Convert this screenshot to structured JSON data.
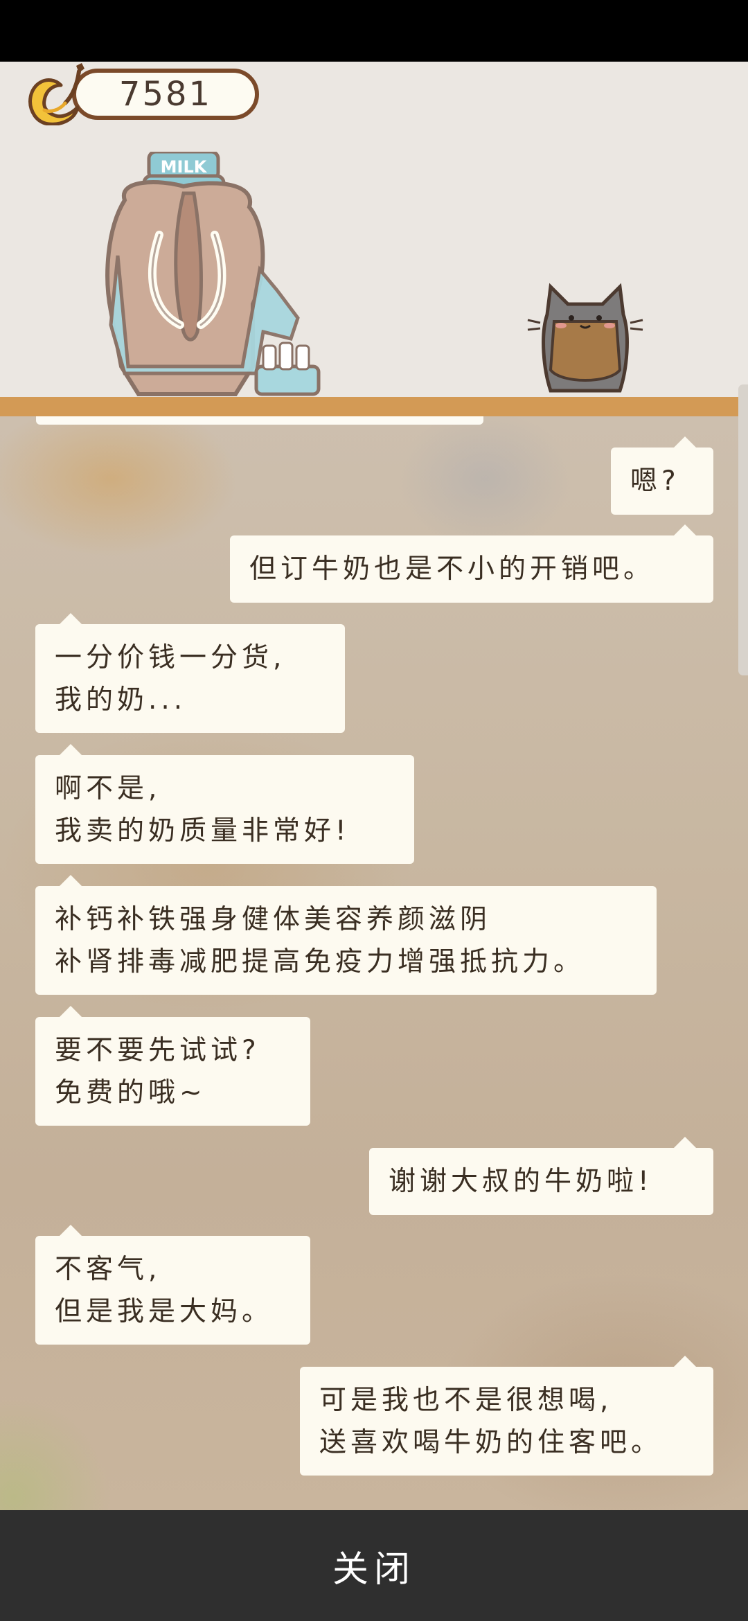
{
  "currency": {
    "value": "7581",
    "icon": "banana-icon"
  },
  "characters": {
    "customer": "mammoth-milkman",
    "host": "gray-cat-apron"
  },
  "chat": {
    "messages": [
      {
        "side": "right",
        "lines": [
          "嗯?"
        ]
      },
      {
        "side": "right",
        "lines": [
          "但订牛奶也是不小的开销吧。"
        ]
      },
      {
        "side": "left",
        "lines": [
          "一分价钱一分货,",
          "我的奶..."
        ]
      },
      {
        "side": "left",
        "lines": [
          "啊不是,",
          "我卖的奶质量非常好!"
        ]
      },
      {
        "side": "left",
        "lines": [
          "补钙补铁强身健体美容养颜滋阴",
          "补肾排毒减肥提高免疫力增强抵抗力。"
        ]
      },
      {
        "side": "left",
        "lines": [
          "要不要先试试?",
          "免费的哦~"
        ]
      },
      {
        "side": "right",
        "lines": [
          "谢谢大叔的牛奶啦!"
        ]
      },
      {
        "side": "left",
        "lines": [
          "不客气,",
          "但是我是大妈。"
        ]
      },
      {
        "side": "right",
        "lines": [
          "可是我也不是很想喝,",
          "送喜欢喝牛奶的住客吧。"
        ]
      }
    ]
  },
  "footer": {
    "close_label": "关闭"
  },
  "colors": {
    "bubble": "#fdfaf0",
    "floor": "#d39a55",
    "footer": "#2f2f2f",
    "scene": "#ebe7e2"
  }
}
